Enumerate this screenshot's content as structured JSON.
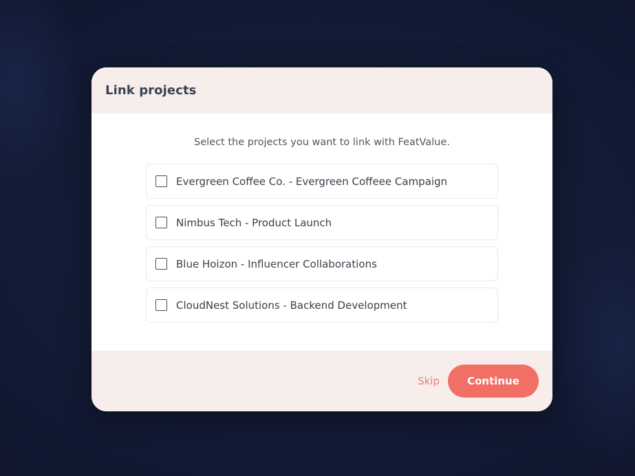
{
  "dialog": {
    "title": "Link projects",
    "instruction": "Select the projects you want to link with FeatValue.",
    "projects": [
      {
        "label": "Evergreen Coffee Co. - Evergreen Coffeee Campaign",
        "checked": false
      },
      {
        "label": "Nimbus Tech - Product Launch",
        "checked": false
      },
      {
        "label": "Blue Hoizon - Influencer Collaborations",
        "checked": false
      },
      {
        "label": "CloudNest Solutions - Backend Development",
        "checked": false
      }
    ],
    "skip_label": "Skip",
    "continue_label": "Continue"
  },
  "colors": {
    "background": "#111933",
    "panel": "#f7eeec",
    "accent": "#f26f66",
    "skip": "#ee7d72",
    "text": "#3b4250"
  }
}
